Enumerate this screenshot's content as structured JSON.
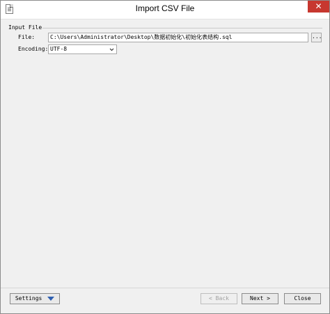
{
  "window": {
    "title": "Import CSV File",
    "close_glyph": "✕"
  },
  "input_file": {
    "group_label": "Input File",
    "file_label": "File:",
    "file_value": "C:\\Users\\Administrator\\Desktop\\数据初始化\\初始化表结构.sql",
    "browse_label": "...",
    "encoding_label": "Encoding:",
    "encoding_value": "UTF-8"
  },
  "footer": {
    "settings_label": "Settings",
    "back_label": "< Back",
    "next_label": "Next >",
    "close_label": "Close"
  },
  "icons": {
    "app": "document-icon",
    "encoding_dropdown": "chevron-down-icon",
    "settings_dropdown": "triangle-down-icon"
  },
  "colors": {
    "close_button": "#c7372f",
    "settings_triangle": "#2f5fb0"
  }
}
